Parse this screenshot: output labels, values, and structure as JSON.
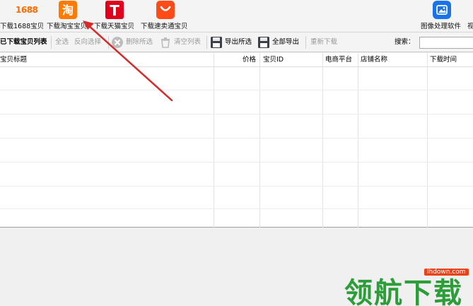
{
  "top_toolbar": {
    "btn_1688_logo": "1688",
    "btn_1688_label": "下载1688宝贝",
    "btn_taobao_glyph": "淘",
    "btn_taobao_label": "下载淘宝宝贝",
    "btn_tmall_glyph": "T",
    "btn_tmall_label": "下载天猫宝贝",
    "btn_aliexpress_label": "下载速卖通宝贝",
    "btn_image_tool_label": "图像处理软件",
    "btn_more_label": "视"
  },
  "action_bar": {
    "downloaded_list": "已下载宝贝列表",
    "select_all": "全选",
    "invert_select": "反向选择",
    "delete_selected": "删除所选",
    "clear_list": "清空列表",
    "export_selected": "导出所选",
    "export_all": "全部导出",
    "redownload": "重新下载",
    "search_label": "搜索：",
    "search_value": ""
  },
  "table": {
    "columns": [
      "宝贝标题",
      "价格",
      "宝贝ID",
      "电商平台",
      "店铺名称",
      "下载时间"
    ],
    "rows": []
  },
  "watermark": {
    "text": "领航下载",
    "url": "lhdown.com"
  },
  "colors": {
    "taobao_orange": "#ff7a00",
    "tmall_red": "#e0001b",
    "aliexpress_orange": "#ff4b18",
    "image_tool_blue": "#1a73e8",
    "annotation_arrow_red": "#d42a2a",
    "watermark_green": "#2d9d3a"
  }
}
